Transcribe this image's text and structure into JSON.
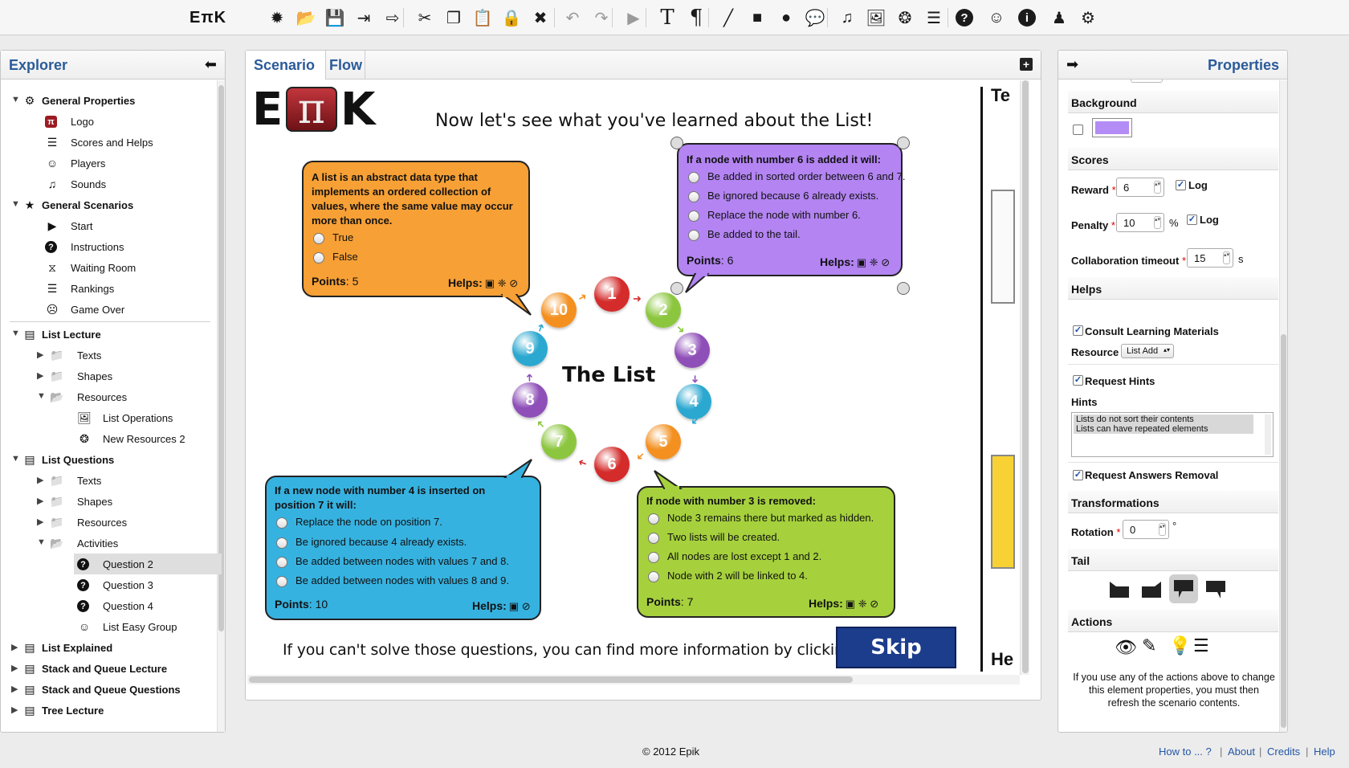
{
  "toolbar": {
    "logo": "EπK",
    "buttons": [
      {
        "name": "new-icon",
        "glyph": "✹"
      },
      {
        "name": "open-folder-icon",
        "glyph": "📂"
      },
      {
        "name": "save-icon",
        "glyph": "💾"
      },
      {
        "name": "import-icon",
        "glyph": "⇥"
      },
      {
        "name": "export-icon",
        "glyph": "⇨"
      },
      {
        "name": "cut-icon",
        "glyph": "✂"
      },
      {
        "name": "copy-icon",
        "glyph": "❐"
      },
      {
        "name": "paste-icon",
        "glyph": "📋"
      },
      {
        "name": "lock-icon",
        "glyph": "🔒"
      },
      {
        "name": "delete-icon",
        "glyph": "✖"
      },
      {
        "name": "undo-icon",
        "glyph": "↶"
      },
      {
        "name": "redo-icon",
        "glyph": "↷"
      },
      {
        "name": "play-icon",
        "glyph": "▶"
      },
      {
        "name": "text-icon",
        "glyph": "T"
      },
      {
        "name": "paragraph-icon",
        "glyph": "¶"
      },
      {
        "name": "line-icon",
        "glyph": "╱"
      },
      {
        "name": "rectangle-icon",
        "glyph": "■"
      },
      {
        "name": "circle-icon",
        "glyph": "●"
      },
      {
        "name": "speech-bubble-icon",
        "glyph": "💬"
      },
      {
        "name": "music-icon",
        "glyph": "♫"
      },
      {
        "name": "image-icon",
        "glyph": "🖼"
      },
      {
        "name": "film-reel-icon",
        "glyph": "❂"
      },
      {
        "name": "document-icon",
        "glyph": "☰"
      },
      {
        "name": "help-icon",
        "glyph": "?"
      },
      {
        "name": "group-chat-icon",
        "glyph": "☺"
      },
      {
        "name": "info-icon",
        "glyph": "i"
      },
      {
        "name": "user-icon",
        "glyph": "♟"
      },
      {
        "name": "settings-icon",
        "glyph": "⚙"
      }
    ]
  },
  "explorer": {
    "title": "Explorer",
    "collapse_glyph": "⬅",
    "items": [
      {
        "label": "General Properties",
        "level": 0,
        "bold": true,
        "arrow": "▼",
        "icon": "gears-icon",
        "glyph": "⚙"
      },
      {
        "label": "Logo",
        "level": 1,
        "icon": "logo-icon",
        "glyph": "π"
      },
      {
        "label": "Scores and Helps",
        "level": 1,
        "icon": "list-icon",
        "glyph": "☰"
      },
      {
        "label": "Players",
        "level": 1,
        "icon": "smiley-icon",
        "glyph": "☺"
      },
      {
        "label": "Sounds",
        "level": 1,
        "icon": "music-icon",
        "glyph": "♫"
      },
      {
        "label": "General Scenarios",
        "level": 0,
        "bold": true,
        "arrow": "▼",
        "icon": "star-box-icon",
        "glyph": "★"
      },
      {
        "label": "Start",
        "level": 1,
        "icon": "play-icon",
        "glyph": "▶"
      },
      {
        "label": "Instructions",
        "level": 1,
        "icon": "question-icon",
        "glyph": "?"
      },
      {
        "label": "Waiting Room",
        "level": 1,
        "icon": "hourglass-icon",
        "glyph": "⧖"
      },
      {
        "label": "Rankings",
        "level": 1,
        "icon": "list-icon",
        "glyph": "☰"
      },
      {
        "label": "Game Over",
        "level": 1,
        "icon": "sad-face-icon",
        "glyph": "☹"
      },
      {
        "label": "List Lecture",
        "level": 0,
        "bold": true,
        "arrow": "▼",
        "icon": "scenario-icon",
        "glyph": "▤",
        "divider": true
      },
      {
        "label": "Texts",
        "level": 2,
        "arrow": "▶",
        "icon": "folder-icon",
        "glyph": "📁"
      },
      {
        "label": "Shapes",
        "level": 2,
        "arrow": "▶",
        "icon": "folder-icon",
        "glyph": "📁"
      },
      {
        "label": "Resources",
        "level": 2,
        "arrow": "▼",
        "icon": "folder-icon",
        "glyph": "📂"
      },
      {
        "label": "List Operations",
        "level": 3,
        "icon": "image-icon",
        "glyph": "🖼"
      },
      {
        "label": "New Resources 2",
        "level": 3,
        "icon": "film-reel-icon",
        "glyph": "❂"
      },
      {
        "label": "List Questions",
        "level": 0,
        "bold": true,
        "arrow": "▼",
        "icon": "scenario-icon",
        "glyph": "▤"
      },
      {
        "label": "Texts",
        "level": 2,
        "arrow": "▶",
        "icon": "folder-icon",
        "glyph": "📁"
      },
      {
        "label": "Shapes",
        "level": 2,
        "arrow": "▶",
        "icon": "folder-icon",
        "glyph": "📁"
      },
      {
        "label": "Resources",
        "level": 2,
        "arrow": "▶",
        "icon": "folder-icon",
        "glyph": "📁"
      },
      {
        "label": "Activities",
        "level": 2,
        "arrow": "▼",
        "icon": "folder-icon",
        "glyph": "📂"
      },
      {
        "label": "Question 2",
        "level": 3,
        "icon": "question-icon",
        "glyph": "?",
        "selected": true
      },
      {
        "label": "Question 3",
        "level": 3,
        "icon": "question-icon",
        "glyph": "?"
      },
      {
        "label": "Question 4",
        "level": 3,
        "icon": "question-icon",
        "glyph": "?"
      },
      {
        "label": "List Easy Group",
        "level": 3,
        "icon": "group-chat-icon",
        "glyph": "☺"
      },
      {
        "label": "List Explained",
        "level": 0,
        "bold": true,
        "arrow": "▶",
        "icon": "scenario-icon",
        "glyph": "▤"
      },
      {
        "label": "Stack and Queue Lecture",
        "level": 0,
        "bold": true,
        "arrow": "▶",
        "icon": "scenario-icon",
        "glyph": "▤"
      },
      {
        "label": "Stack and Queue Questions",
        "level": 0,
        "bold": true,
        "arrow": "▶",
        "icon": "scenario-icon",
        "glyph": "▤"
      },
      {
        "label": "Tree Lecture",
        "level": 0,
        "bold": true,
        "arrow": "▶",
        "icon": "scenario-icon",
        "glyph": "▤"
      }
    ]
  },
  "tabs": {
    "scenario": "Scenario",
    "flow": "Flow",
    "add_glyph": "+"
  },
  "canvas": {
    "logo_e": "E",
    "logo_pi": "π",
    "logo_k": "K",
    "heading": "Now let's see what you've learned about the List!",
    "center_title": "The List",
    "nodes": [
      {
        "n": "1",
        "color": "#d42b2b"
      },
      {
        "n": "2",
        "color": "#8cc63f"
      },
      {
        "n": "3",
        "color": "#8f4fb8"
      },
      {
        "n": "4",
        "color": "#2ba8d0"
      },
      {
        "n": "5",
        "color": "#f39020"
      },
      {
        "n": "6",
        "color": "#d42b2b"
      },
      {
        "n": "7",
        "color": "#8cc63f"
      },
      {
        "n": "8",
        "color": "#8f4fb8"
      },
      {
        "n": "9",
        "color": "#2ba8d0"
      },
      {
        "n": "10",
        "color": "#f39020"
      }
    ],
    "q_orange": {
      "question": "A list is an abstract data type that implements an ordered collection of values, where the same value may occur more than once.",
      "options": [
        "True",
        "False"
      ],
      "points_label": "Points",
      "points": "5",
      "helps_label": "Helps:",
      "help_icons": "▣ ❈ ⊘"
    },
    "q_purple": {
      "question": "If a node with number 6 is added it will:",
      "options": [
        "Be added in sorted order between 6 and 7.",
        "Be ignored because 6 already exists.",
        "Replace the node with number 6.",
        "Be added to the tail."
      ],
      "points_label": "Points",
      "points": "6",
      "helps_label": "Helps:",
      "help_icons": "▣ ❈ ⊘"
    },
    "q_blue": {
      "question": "If a new node with number 4 is inserted on position 7 it will:",
      "options": [
        "Replace the node on position 7.",
        "Be ignored because 4 already exists.",
        "Be added between nodes with values 7 and 8.",
        "Be added between nodes with values 8 and 9."
      ],
      "points_label": "Points",
      "points": "10",
      "helps_label": "Helps:",
      "help_icons": "▣ ⊘"
    },
    "q_green": {
      "question": "If node with number 3 is removed:",
      "options": [
        "Node 3 remains there but marked as hidden.",
        "Two lists will be created.",
        "All nodes are lost except 1 and 2.",
        "Node with 2 will be linked to 4."
      ],
      "points_label": "Points",
      "points": "7",
      "helps_label": "Helps:",
      "help_icons": "▣ ❈ ⊘"
    },
    "bottom_text": "If you can't solve those questions, you can find more information by clicking here:",
    "skip_label": "Skip",
    "side_top": "Te",
    "side_bottom": "He"
  },
  "properties": {
    "title": "Properties",
    "expand_glyph": "➡",
    "background": {
      "section": "Background",
      "color": "#b48cf5"
    },
    "scores": {
      "section": "Scores",
      "reward_label": "Reward",
      "reward": "6",
      "log_label": "Log",
      "penalty_label": "Penalty",
      "penalty": "10",
      "percent": "%",
      "timeout_label": "Collaboration timeout",
      "timeout": "15",
      "seconds": "s"
    },
    "helps": {
      "section": "Helps",
      "consult_label": "Consult Learning Materials",
      "resource_label": "Resource",
      "resource_value": "List Add",
      "hints_toggle_label": "Request Hints",
      "hints_label": "Hints",
      "hints": [
        "Lists do not sort their contents",
        "Lists can have repeated elements"
      ],
      "removal_label": "Request Answers Removal"
    },
    "transformations": {
      "section": "Transformations",
      "rotation_label": "Rotation",
      "rotation": "0",
      "degree": "°"
    },
    "tail": {
      "section": "Tail"
    },
    "actions": {
      "section": "Actions",
      "note": "If you use any of the actions above to change this element properties, you must then refresh the scenario contents."
    }
  },
  "footer": {
    "copyright": "© 2012 Epik",
    "links": [
      "How to ... ?",
      "About",
      "Credits",
      "Help"
    ],
    "sep": "|"
  }
}
